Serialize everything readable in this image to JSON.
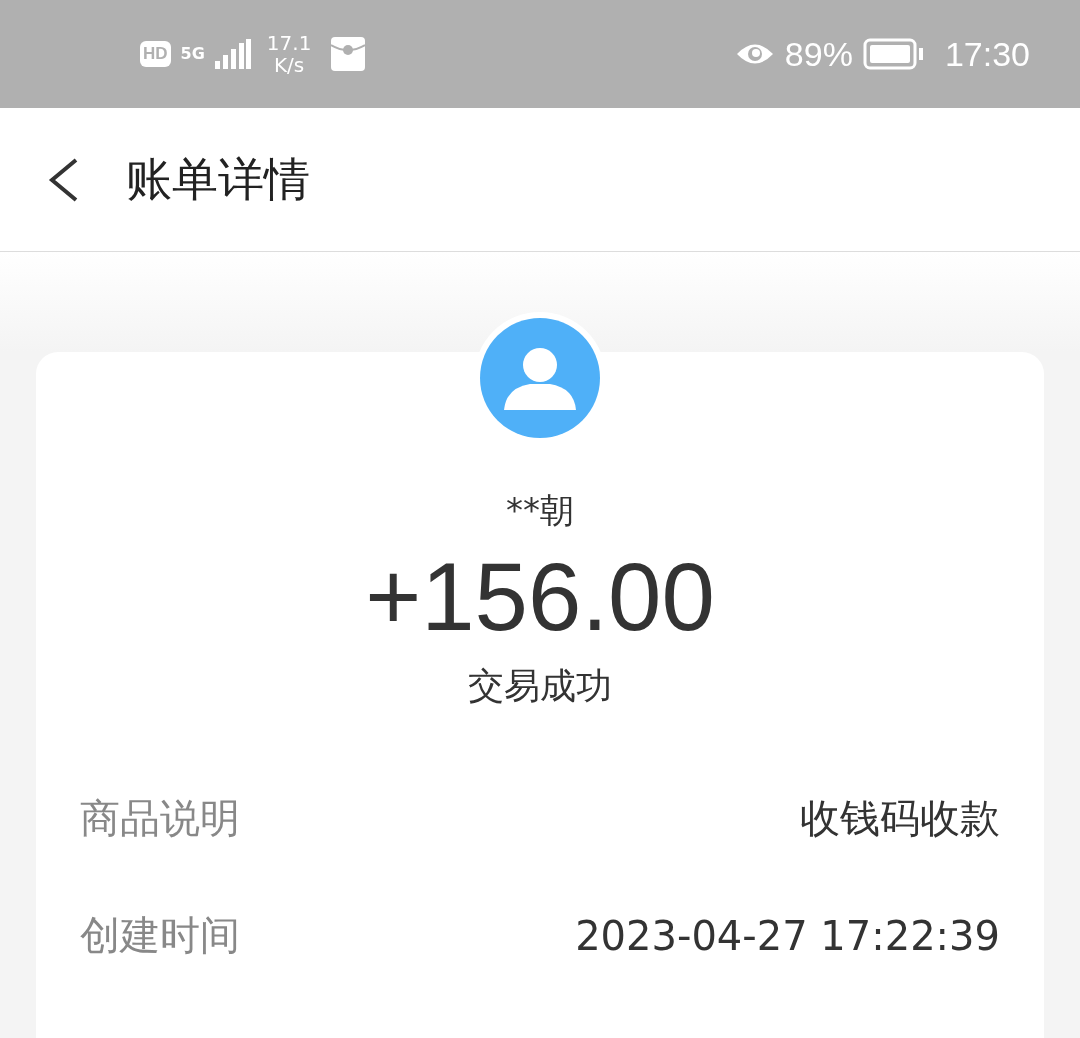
{
  "status_bar": {
    "hd": "HD",
    "network": "5G",
    "speed_value": "17.1",
    "speed_unit": "K/s",
    "battery": "89%",
    "time": "17:30"
  },
  "header": {
    "title": "账单详情"
  },
  "bill": {
    "payer": "**朝",
    "amount": "+156.00",
    "status": "交易成功",
    "details": [
      {
        "label": "商品说明",
        "value": "收钱码收款"
      },
      {
        "label": "创建时间",
        "value": "2023-04-27 17:22:39"
      }
    ]
  }
}
